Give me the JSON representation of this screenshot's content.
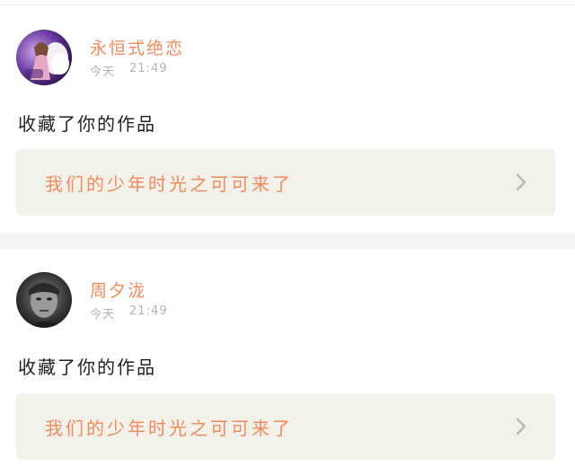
{
  "feed": [
    {
      "username": "永恒式绝恋",
      "time_day": "今天",
      "time_clock": "21:49",
      "action": "收藏了你的作品",
      "work_title": "我们的少年时光之可可来了",
      "avatar": "avatar-girl-with-white-wings"
    },
    {
      "username": "周夕泷",
      "time_day": "今天",
      "time_clock": "21:49",
      "action": "收藏了你的作品",
      "work_title": "我们的少年时光之可可来了",
      "avatar": "avatar-grayscale-face"
    }
  ],
  "colors": {
    "accent": "#f28a5c",
    "muted": "#b3b3b3",
    "box_bg": "#f2f2ea",
    "text": "#222222"
  }
}
